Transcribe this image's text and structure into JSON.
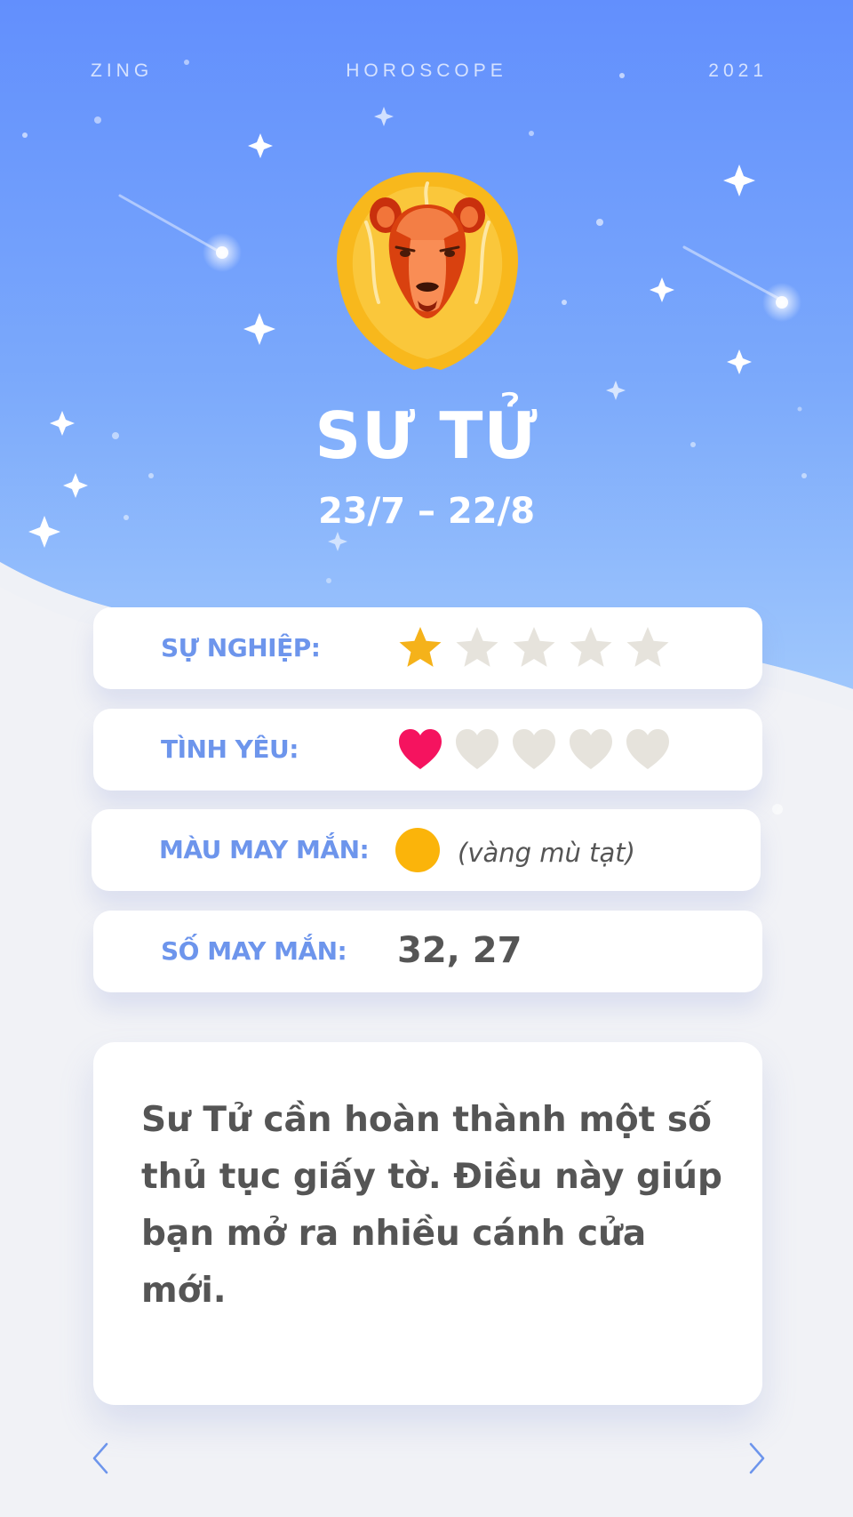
{
  "header": {
    "brand": "ZING",
    "section": "HOROSCOPE",
    "year": "2021"
  },
  "sign": {
    "name": "SƯ TỬ",
    "dates": "23/7 – 22/8",
    "icon": "lion-icon"
  },
  "career": {
    "label": "SỰ NGHIỆP:",
    "rating": 1,
    "max": 5,
    "icon": "star-icon"
  },
  "love": {
    "label": "TÌNH YÊU:",
    "rating": 1,
    "max": 5,
    "icon": "heart-icon"
  },
  "lucky_color": {
    "label": "MÀU MAY MẮN:",
    "value": "(vàng mù tạt)",
    "swatch": "#fbb40a"
  },
  "lucky_number": {
    "label": "SỐ MAY MẮN:",
    "value": "32, 27"
  },
  "description": "Sư Tử cần hoàn thành một số thủ tục giấy tờ. Điều này giúp bạn mở ra nhiều cánh cửa mới.",
  "colors": {
    "accent": "#6d95ec",
    "star_active": "#f5b21a",
    "heart_active": "#f5135f",
    "inactive": "#e6e3dc"
  },
  "navigation": {
    "prev_icon": "chevron-left-icon",
    "next_icon": "chevron-right-icon"
  }
}
